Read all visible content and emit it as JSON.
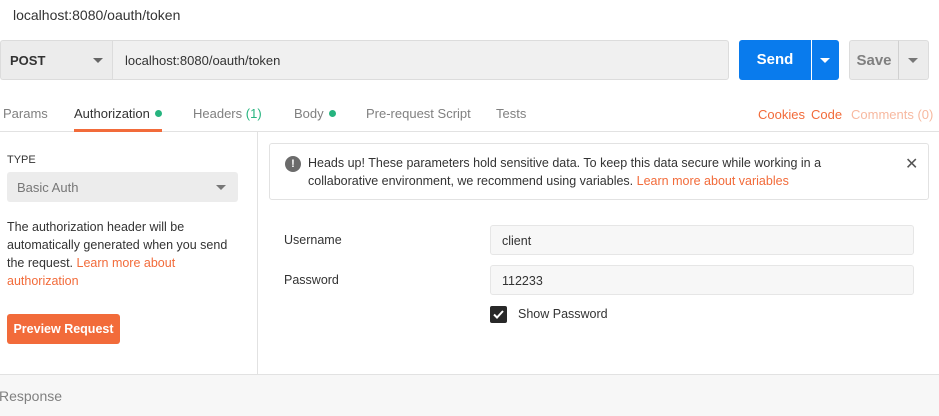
{
  "title": "localhost:8080/oauth/token",
  "request": {
    "method": "POST",
    "url": "localhost:8080/oauth/token",
    "send_label": "Send",
    "save_label": "Save"
  },
  "tabs": {
    "params": "Params",
    "authorization": "Authorization",
    "headers": "Headers",
    "headers_count": "(1)",
    "body": "Body",
    "prerequest": "Pre-request Script",
    "tests": "Tests",
    "cookies": "Cookies",
    "code": "Code",
    "comments": "Comments (0)"
  },
  "auth": {
    "type_label": "TYPE",
    "type_value": "Basic Auth",
    "description": "The authorization header will be automatically generated when you send the request. ",
    "learn_more": "Learn more about authorization",
    "preview_label": "Preview Request"
  },
  "alert": {
    "text": "Heads up! These parameters hold sensitive data. To keep this data secure while working in a collaborative environment, we recommend using variables. ",
    "link": "Learn more about variables"
  },
  "fields": {
    "username_label": "Username",
    "username_value": "client",
    "password_label": "Password",
    "password_value": "112233",
    "show_password_label": "Show Password",
    "show_password_checked": true
  },
  "response": {
    "label": "Response"
  },
  "colors": {
    "accent": "#f26b3a",
    "send_blue": "#097bed",
    "indicator_green": "#26b47f"
  }
}
